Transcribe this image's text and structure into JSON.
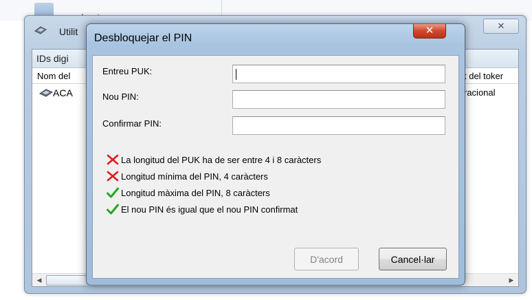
{
  "background": {
    "top_item_text": "Imatges",
    "window_title": "Utilit",
    "close_glyph": "✕",
    "tab_label": "IDs digi",
    "columns": [
      "Nom del",
      "t del toker"
    ],
    "rows": [
      {
        "name": "ACA",
        "status": "racional"
      }
    ],
    "scroll_left_glyph": "◀",
    "scroll_right_glyph": "▶"
  },
  "dialog": {
    "title": "Desbloquejar el PIN",
    "close_glyph": "✕",
    "fields": [
      {
        "label": "Entreu PUK:",
        "value": ""
      },
      {
        "label": "Nou PIN:",
        "value": ""
      },
      {
        "label": "Confirmar PIN:",
        "value": ""
      }
    ],
    "rules": [
      {
        "text": "La longitud del PUK ha de ser entre 4 i 8 caràcters",
        "status": "invalid",
        "icon": "cross-icon"
      },
      {
        "text": "Longitud mínima del PIN, 4 caràcters",
        "status": "invalid",
        "icon": "cross-icon"
      },
      {
        "text": "Longitud màxima del PIN, 8 caràcters",
        "status": "valid",
        "icon": "check-icon"
      },
      {
        "text": "El nou PIN és igual que el nou PIN confirmat",
        "status": "valid",
        "icon": "check-icon"
      }
    ],
    "ok_label": "D'acord",
    "ok_enabled": false,
    "cancel_label": "Cancel·lar"
  },
  "colors": {
    "cross": "#e01b1b",
    "check": "#1fa81f",
    "title_bar": "#a9c4e0",
    "close_button": "#c7432a"
  }
}
